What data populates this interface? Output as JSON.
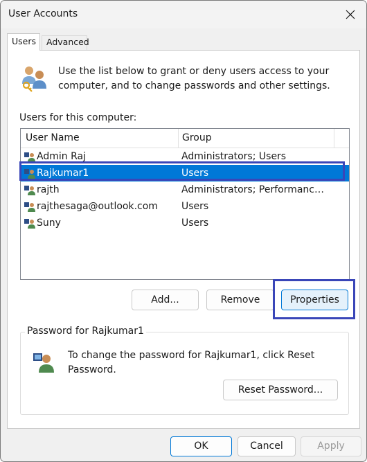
{
  "window": {
    "title": "User Accounts"
  },
  "tabs": [
    {
      "label": "Users",
      "active": true
    },
    {
      "label": "Advanced",
      "active": false
    }
  ],
  "intro": {
    "text": "Use the list below to grant or deny users access to your computer, and to change passwords and other settings.",
    "icon": "users-keys-icon"
  },
  "users_section": {
    "label": "Users for this computer:",
    "columns": [
      "User Name",
      "Group"
    ],
    "rows": [
      {
        "name": "Admin Raj",
        "group": "Administrators; Users",
        "selected": false
      },
      {
        "name": "Rajkumar1",
        "group": "Users",
        "selected": true
      },
      {
        "name": "rajth",
        "group": "Administrators; Performance L...",
        "selected": false
      },
      {
        "name": "rajthesaga@outlook.com",
        "group": "Users",
        "selected": false
      },
      {
        "name": "Suny",
        "group": "Users",
        "selected": false
      }
    ]
  },
  "actions": {
    "add": "Add...",
    "remove": "Remove",
    "properties": "Properties"
  },
  "password_section": {
    "title": "Password for Rajkumar1",
    "text": "To change the password for Rajkumar1, click Reset Password.",
    "reset_button": "Reset Password..."
  },
  "footer": {
    "ok": "OK",
    "cancel": "Cancel",
    "apply": "Apply"
  },
  "colors": {
    "selection": "#0078d7",
    "annotation": "#3a46b8"
  }
}
